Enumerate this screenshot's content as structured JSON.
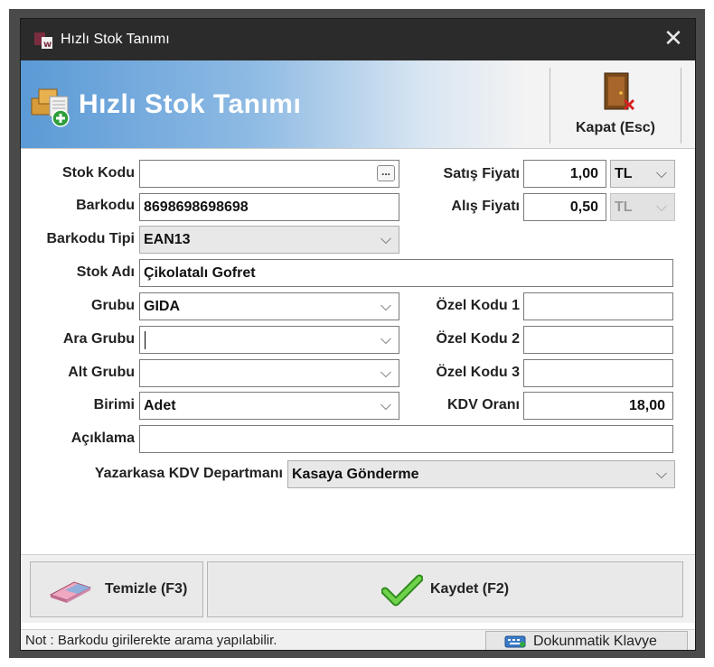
{
  "window": {
    "title": "Hızlı Stok Tanımı",
    "app_icon": "w-logo-icon",
    "close_glyph": "✕"
  },
  "banner": {
    "title": "Hızlı Stok Tanımı",
    "icon": "boxes-add-icon",
    "close_tool": {
      "label": "Kapat (Esc)",
      "icon": "door-close-icon"
    }
  },
  "form": {
    "stok_kodu": {
      "label": "Stok Kodu",
      "value": "",
      "browse": "..."
    },
    "barkodu": {
      "label": "Barkodu",
      "value": "8698698698698"
    },
    "barkodu_tipi": {
      "label": "Barkodu Tipi",
      "value": "EAN13"
    },
    "stok_adi": {
      "label": "Stok Adı",
      "value": "Çikolatalı Gofret"
    },
    "grubu": {
      "label": "Grubu",
      "value": "GIDA"
    },
    "ara_grubu": {
      "label": "Ara Grubu",
      "value": ""
    },
    "alt_grubu": {
      "label": "Alt Grubu",
      "value": ""
    },
    "birimi": {
      "label": "Birimi",
      "value": "Adet"
    },
    "aciklama": {
      "label": "Açıklama",
      "value": ""
    },
    "yazarkasa": {
      "label": "Yazarkasa KDV Departmanı",
      "value": "Kasaya Gönderme"
    },
    "satis_fiyati": {
      "label": "Satış Fiyatı",
      "value": "1,00",
      "currency": "TL"
    },
    "alis_fiyati": {
      "label": "Alış Fiyatı",
      "value": "0,50",
      "currency": "TL"
    },
    "ozel_kodu_1": {
      "label": "Özel Kodu 1",
      "value": ""
    },
    "ozel_kodu_2": {
      "label": "Özel Kodu 2",
      "value": ""
    },
    "ozel_kodu_3": {
      "label": "Özel Kodu 3",
      "value": ""
    },
    "kdv_orani": {
      "label": "KDV Oranı",
      "value": "18,00"
    }
  },
  "buttons": {
    "temizle": {
      "label": "Temizle (F3)",
      "icon": "eraser-icon"
    },
    "kaydet": {
      "label": "Kaydet (F2)",
      "icon": "checkmark-icon"
    }
  },
  "status": {
    "note": "Not : Barkodu girilerekte arama yapılabilir.",
    "keyboard_button": {
      "label": "Dokunmatik Klavye",
      "icon": "keyboard-icon"
    }
  },
  "colors": {
    "banner_start": "#5b9ad6",
    "check_green": "#3fae2a",
    "focus_border": "#3a7bd5"
  }
}
